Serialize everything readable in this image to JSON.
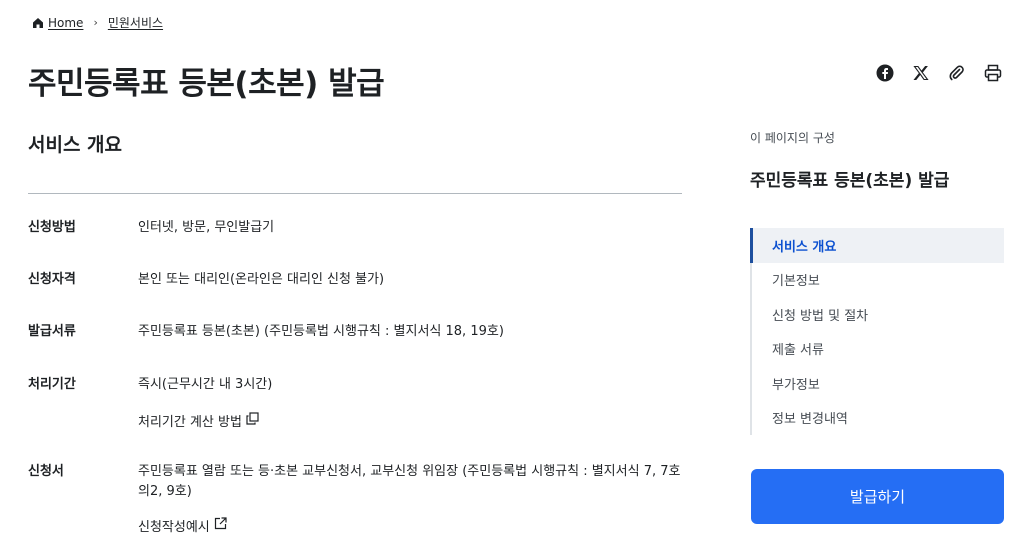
{
  "breadcrumb": {
    "home": "Home",
    "current": "민원서비스"
  },
  "page": {
    "title": "주민등록표 등본(초본) 발급"
  },
  "share": {
    "icons": [
      "facebook-icon",
      "x-icon",
      "link-icon",
      "print-icon"
    ]
  },
  "overview": {
    "title": "서비스 개요",
    "rows": [
      {
        "label": "신청방법",
        "value": "인터넷, 방문, 무인발급기"
      },
      {
        "label": "신청자격",
        "value": "본인 또는 대리인(온라인은 대리인 신청 불가)"
      },
      {
        "label": "발급서류",
        "value": "주민등록표 등본(초본) (주민등록법 시행규칙 : 별지서식 18, 19호)"
      },
      {
        "label": "처리기간",
        "value": "즉시(근무시간 내 3시간)",
        "link": "처리기간 계산 방법"
      },
      {
        "label": "신청서",
        "value": "주민등록표 열람 또는 등·초본 교부신청서, 교부신청 위임장 (주민등록법 시행규칙 : 별지서식 7, 7호의2, 9호)",
        "link": "신청작성예시"
      }
    ]
  },
  "toc": {
    "caption": "이 페이지의 구성",
    "title": "주민등록표 등본(초본) 발급",
    "items": [
      "서비스 개요",
      "기본정보",
      "신청 방법 및 절차",
      "제출 서류",
      "부가정보",
      "정보 변경내역"
    ]
  },
  "apply": {
    "label": "발급하기"
  },
  "colors": {
    "primary": "#256ef4",
    "active_bg": "#eef1f5",
    "active_text": "#0b50d0"
  }
}
